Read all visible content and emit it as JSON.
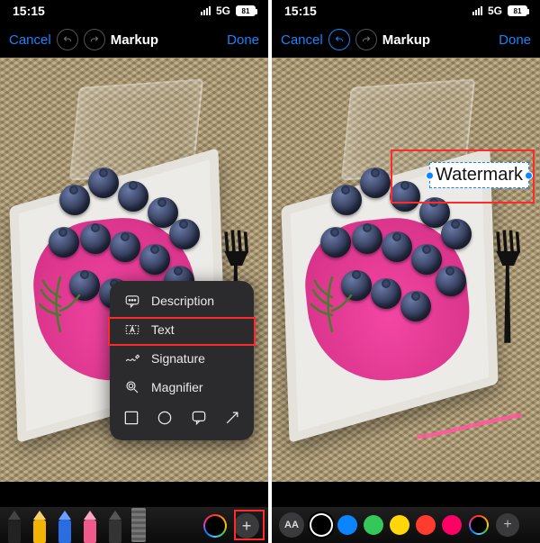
{
  "status": {
    "time": "15:15",
    "network": "5G",
    "battery": "81"
  },
  "nav": {
    "cancel": "Cancel",
    "title": "Markup",
    "done": "Done"
  },
  "popup": {
    "description": "Description",
    "text": "Text",
    "signature": "Signature",
    "magnifier": "Magnifier"
  },
  "watermark": {
    "label": "Watermark"
  },
  "toolbar_right": {
    "aa": "AA",
    "colors": [
      "#000000",
      "#0a84ff",
      "#34c759",
      "#ffd60a",
      "#ff3b30",
      "#ff0066"
    ],
    "selected_index": 0
  },
  "icons": {
    "plus": "+"
  }
}
